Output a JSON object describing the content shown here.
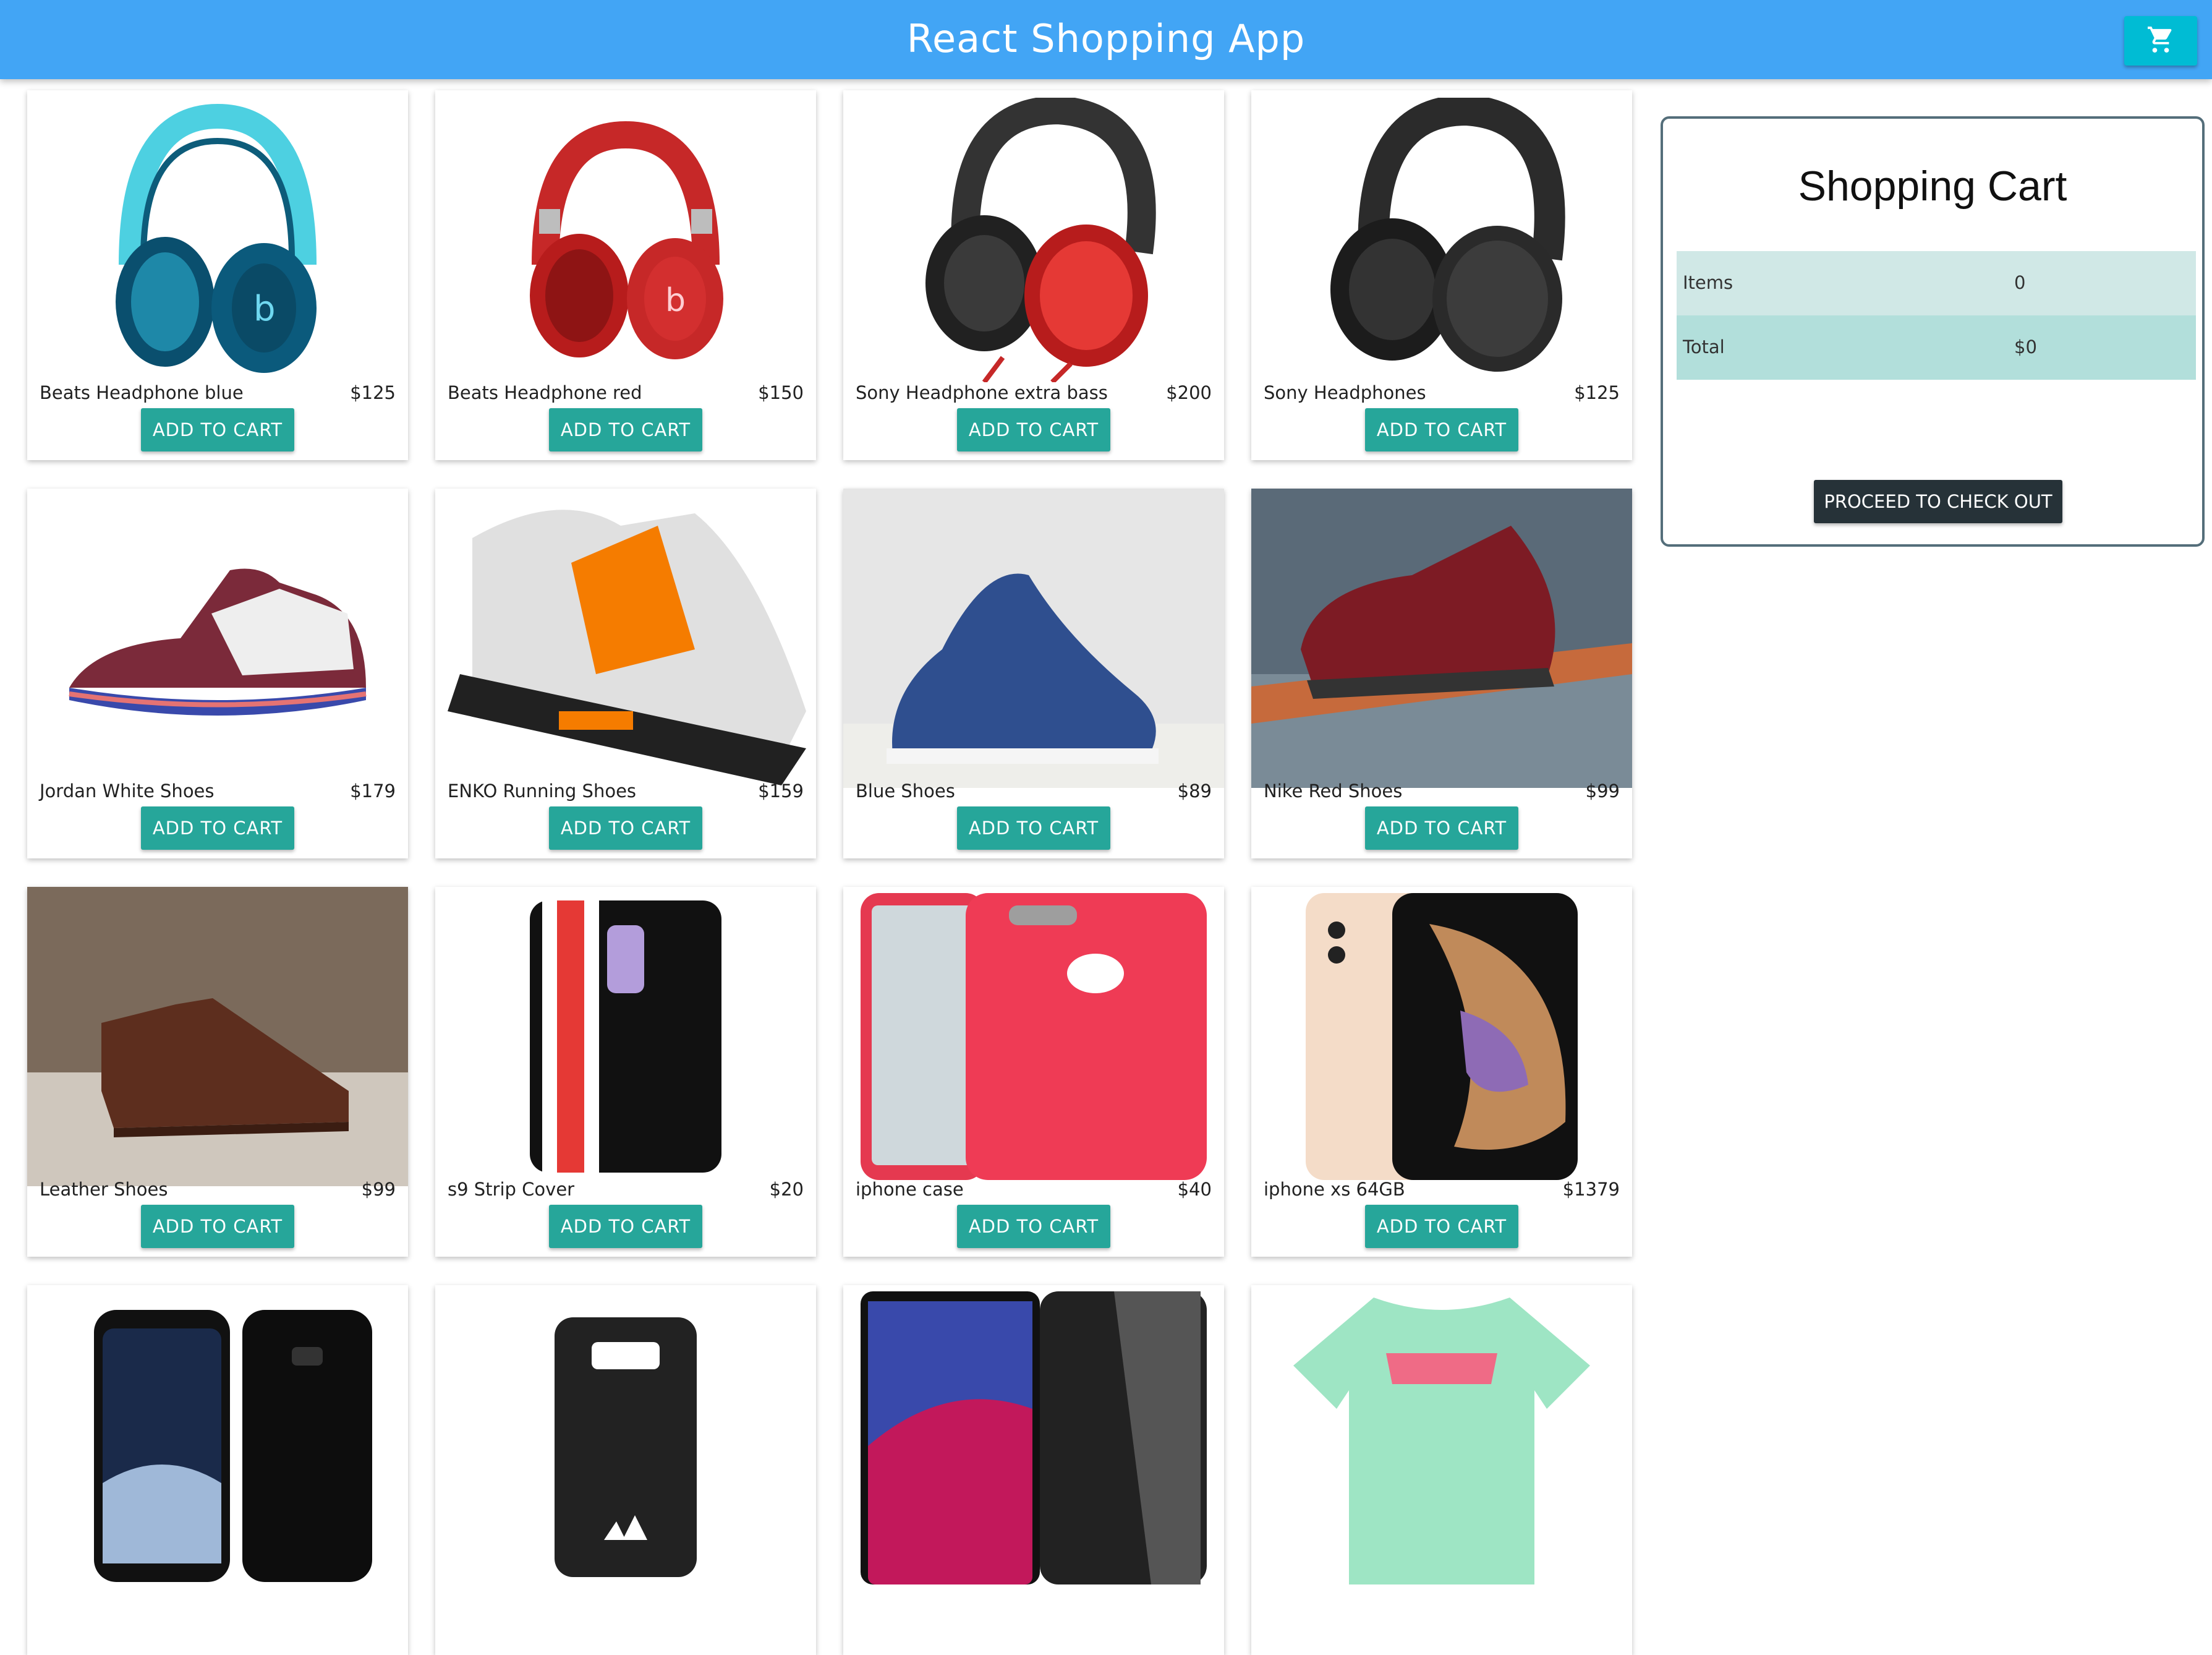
{
  "app": {
    "title": "React Shopping App"
  },
  "header": {
    "cart_icon": "shopping-cart-icon"
  },
  "button_label": "ADD TO CART",
  "products": [
    {
      "name": "Beats Headphone blue",
      "price": "$125"
    },
    {
      "name": "Beats Headphone red",
      "price": "$150"
    },
    {
      "name": "Sony Headphone extra bass",
      "price": "$200"
    },
    {
      "name": "Sony Headphones",
      "price": "$125"
    },
    {
      "name": "Jordan White Shoes",
      "price": "$179"
    },
    {
      "name": "ENKO Running Shoes",
      "price": "$159"
    },
    {
      "name": "Blue Shoes",
      "price": "$89"
    },
    {
      "name": "Nike Red Shoes",
      "price": "$99"
    },
    {
      "name": "Leather Shoes",
      "price": "$99"
    },
    {
      "name": "s9 Strip Cover",
      "price": "$20"
    },
    {
      "name": "iphone case",
      "price": "$40"
    },
    {
      "name": "iphone xs 64GB",
      "price": "$1379"
    }
  ],
  "cart": {
    "heading": "Shopping Cart",
    "items_label": "Items",
    "items_value": "0",
    "total_label": "Total",
    "total_value": "$0",
    "checkout_label": "PROCEED TO CHECK OUT"
  },
  "colors": {
    "appbar": "#42a5f5",
    "cart_button": "#00bcd4",
    "add_button": "#26a69a",
    "checkout_button": "#263238"
  }
}
